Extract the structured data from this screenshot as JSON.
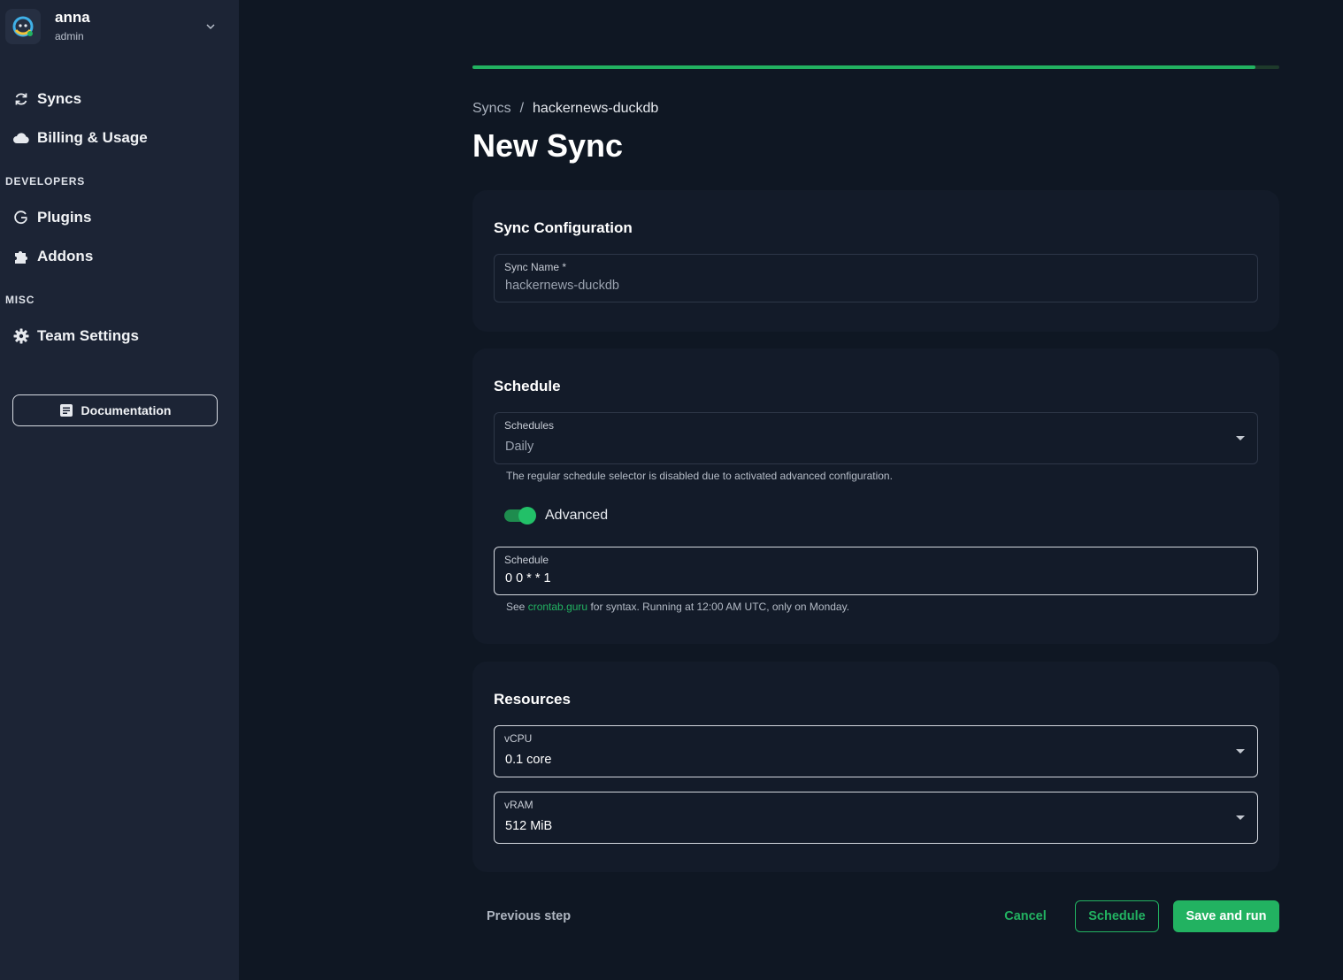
{
  "user": {
    "name": "anna",
    "role": "admin"
  },
  "nav": {
    "syncs": "Syncs",
    "billing": "Billing & Usage",
    "developers_label": "DEVELOPERS",
    "plugins": "Plugins",
    "addons": "Addons",
    "misc_label": "MISC",
    "team_settings": "Team Settings",
    "documentation": "Documentation"
  },
  "progress": {
    "value": 0.97
  },
  "breadcrumb": {
    "parent": "Syncs",
    "separator": "/",
    "current": "hackernews-duckdb"
  },
  "page_title": "New Sync",
  "sync_config": {
    "title": "Sync Configuration",
    "name_label": "Sync Name *",
    "name_value": "hackernews-duckdb"
  },
  "schedule": {
    "title": "Schedule",
    "schedules_label": "Schedules",
    "schedules_value": "Daily",
    "disabled_note": "The regular schedule selector is disabled due to activated advanced configuration.",
    "advanced_label": "Advanced",
    "advanced_on": true,
    "cron_label": "Schedule",
    "cron_value": "0 0 * * 1",
    "help_prefix": "See",
    "help_link": "crontab.guru",
    "help_suffix": "for syntax. Running at 12:00 AM UTC, only on Monday."
  },
  "resources": {
    "title": "Resources",
    "vcpu_label": "vCPU",
    "vcpu_value": "0.1 core",
    "vram_label": "vRAM",
    "vram_value": "512 MiB"
  },
  "footer": {
    "previous": "Previous step",
    "cancel": "Cancel",
    "schedule": "Schedule",
    "save_run": "Save and run"
  },
  "colors": {
    "accent": "#22b261",
    "sidebar_bg": "#1c2435",
    "page_bg": "#0f1723",
    "card_bg": "#131b29"
  }
}
